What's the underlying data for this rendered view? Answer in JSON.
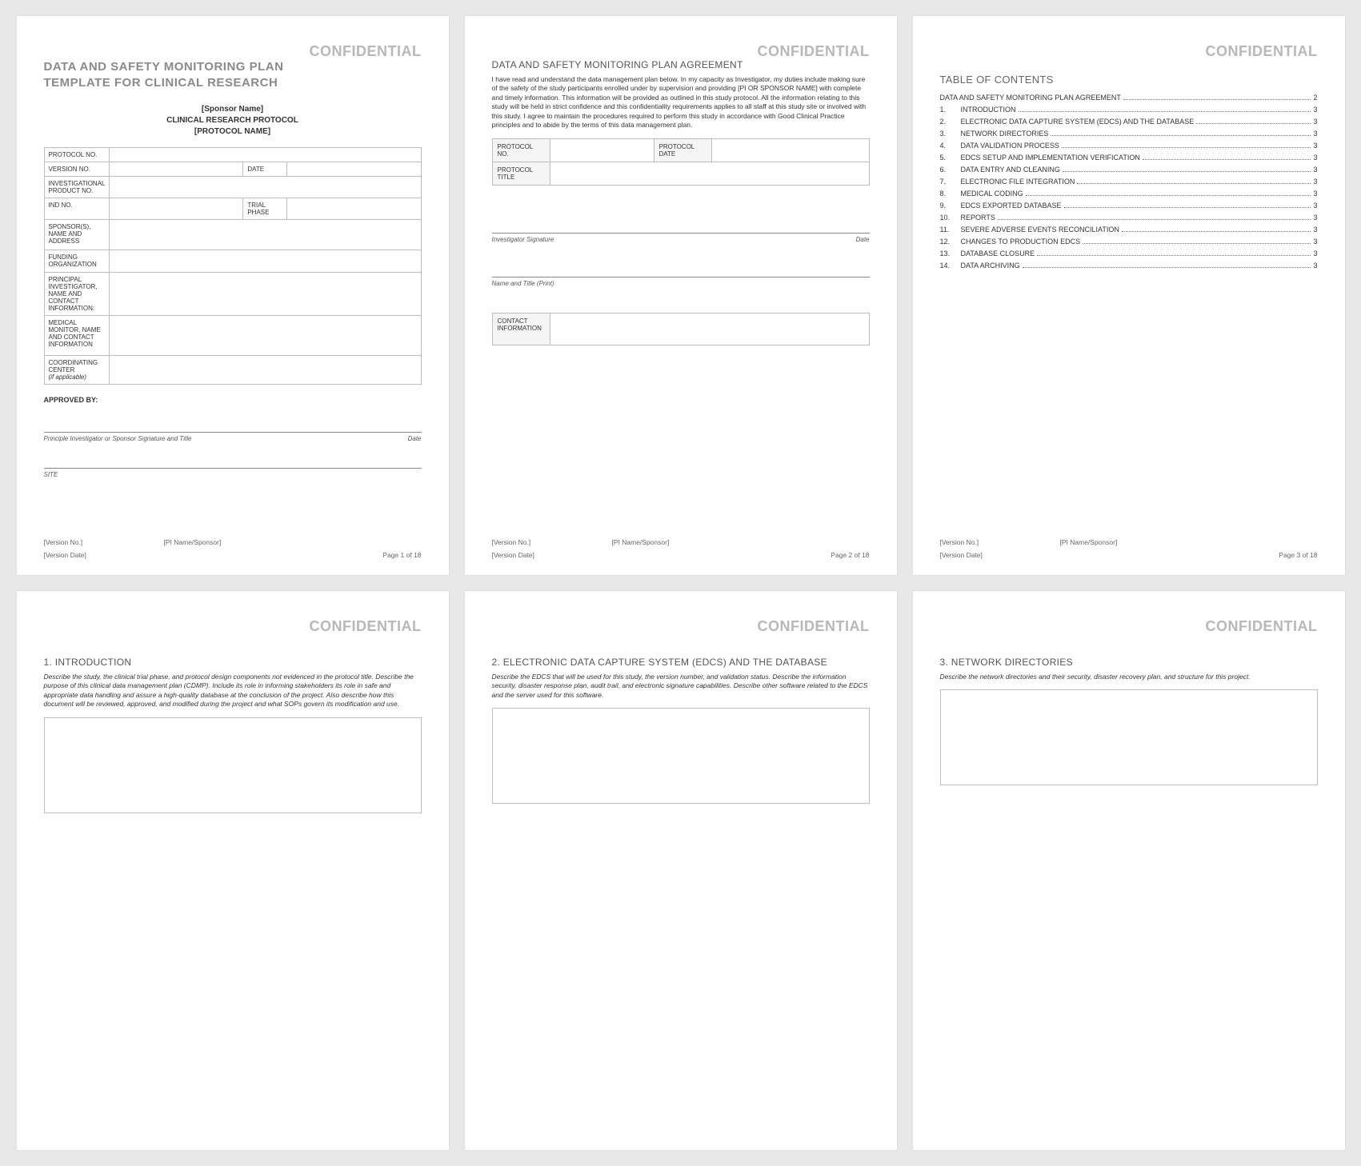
{
  "confidential": "CONFIDENTIAL",
  "doc_title_l1": "DATA AND SAFETY MONITORING PLAN",
  "doc_title_l2": "TEMPLATE FOR CLINICAL RESEARCH",
  "center": {
    "sponsor": "[Sponsor Name]",
    "protocol": "CLINICAL RESEARCH PROTOCOL",
    "name": "[PROTOCOL NAME]"
  },
  "form": {
    "protocol_no": "PROTOCOL NO.",
    "version_no": "VERSION NO.",
    "date": "DATE",
    "inv_product": "INVESTIGATIONAL PRODUCT NO.",
    "ind_no": "IND NO.",
    "trial_phase": "TRIAL PHASE",
    "sponsor": "SPONSOR(S), NAME AND ADDRESS",
    "funding": "FUNDING ORGANIZATION",
    "pi": "PRINCIPAL INVESTIGATOR, NAME AND CONTACT INFORMATION:",
    "medical": "MEDICAL MONITOR, NAME AND CONTACT INFORMATION",
    "coord": "COORDINATING CENTER",
    "coord_note": "(if applicable)"
  },
  "approved": "APPROVED BY:",
  "sig1": {
    "l": "Principle Investigator or Sponsor Signature and Title",
    "r": "Date"
  },
  "sig2": {
    "l": "SITE"
  },
  "footer": {
    "version": "[Version No.]",
    "pi": "[PI Name/Sponsor]",
    "vdate": "[Version Date]",
    "page1": "Page 1 of 18",
    "page2": "Page 2 of 18",
    "page3": "Page 3 of 18"
  },
  "p2": {
    "title": "DATA AND SAFETY MONITORING PLAN AGREEMENT",
    "para": "I have read and understand the data management plan below. In my capacity as Investigator, my duties include making sure of the safety of the study participants enrolled under by supervision and providing [PI OR SPONSOR NAME] with complete and timely information. This information will be provided as outlined in this study protocol. All the information relating to this study will be held in strict confidence and this confidentiality requirements applies to all staff at this study site or involved with this study. I agree to maintain the procedures required to perform this study in accordance with Good Clinical Practice principles and to abide by the terms of this data management plan.",
    "protocol_no": "PROTOCOL NO.",
    "protocol_date": "PROTOCOL DATE",
    "protocol_title": "PROTOCOL TITLE",
    "sig": "Investigator Signature",
    "date": "Date",
    "nametitle": "Name and Title (Print)",
    "contact": "CONTACT INFORMATION"
  },
  "p3": {
    "toc_title": "TABLE OF CONTENTS",
    "first": {
      "label": "DATA AND SAFETY MONITORING PLAN AGREEMENT",
      "pg": "2"
    },
    "items": [
      {
        "n": "1.",
        "label": "INTRODUCTION",
        "pg": "3"
      },
      {
        "n": "2.",
        "label": "ELECTRONIC DATA CAPTURE SYSTEM (EDCS) AND THE DATABASE",
        "pg": "3"
      },
      {
        "n": "3.",
        "label": "NETWORK DIRECTORIES",
        "pg": "3"
      },
      {
        "n": "4.",
        "label": "DATA VALIDATION PROCESS",
        "pg": "3"
      },
      {
        "n": "5.",
        "label": "EDCS SETUP AND IMPLEMENTATION VERIFICATION",
        "pg": "3"
      },
      {
        "n": "6.",
        "label": "DATA ENTRY AND CLEANING",
        "pg": "3"
      },
      {
        "n": "7.",
        "label": "ELECTRONIC FILE INTEGRATION",
        "pg": "3"
      },
      {
        "n": "8.",
        "label": "MEDICAL CODING",
        "pg": "3"
      },
      {
        "n": "9.",
        "label": "EDCS EXPORTED DATABASE",
        "pg": "3"
      },
      {
        "n": "10.",
        "label": "REPORTS",
        "pg": "3"
      },
      {
        "n": "11.",
        "label": "SEVERE ADVERSE EVENTS RECONCILIATION",
        "pg": "3"
      },
      {
        "n": "12.",
        "label": "CHANGES TO PRODUCTION EDCS",
        "pg": "3"
      },
      {
        "n": "13.",
        "label": "DATABASE CLOSURE",
        "pg": "3"
      },
      {
        "n": "14.",
        "label": "DATA ARCHIVING",
        "pg": "3"
      }
    ]
  },
  "p4": {
    "title": "1.  INTRODUCTION",
    "text": "Describe the study, the clinical trial phase, and protocol design components not evidenced in the protocol title. Describe the purpose of this clinical data management plan (CDMP). Include its role in informing stakeholders its role in safe and appropriate data handling and assure a high-quality database at the conclusion of the project. Also describe how this document will be reviewed, approved, and modified during the project and what SOPs govern its modification and use."
  },
  "p5": {
    "title": "2.  ELECTRONIC DATA CAPTURE SYSTEM (EDCS) AND THE DATABASE",
    "text": "Describe the EDCS that will be used for this study, the version number, and validation status. Describe the information security, disaster response plan, audit trail, and electronic signature capabilities. Describe other software related to the EDCS and the server used for this software."
  },
  "p6": {
    "title": "3.  NETWORK DIRECTORIES",
    "text": "Describe the network directories and their security, disaster recovery plan, and structure for this project."
  }
}
